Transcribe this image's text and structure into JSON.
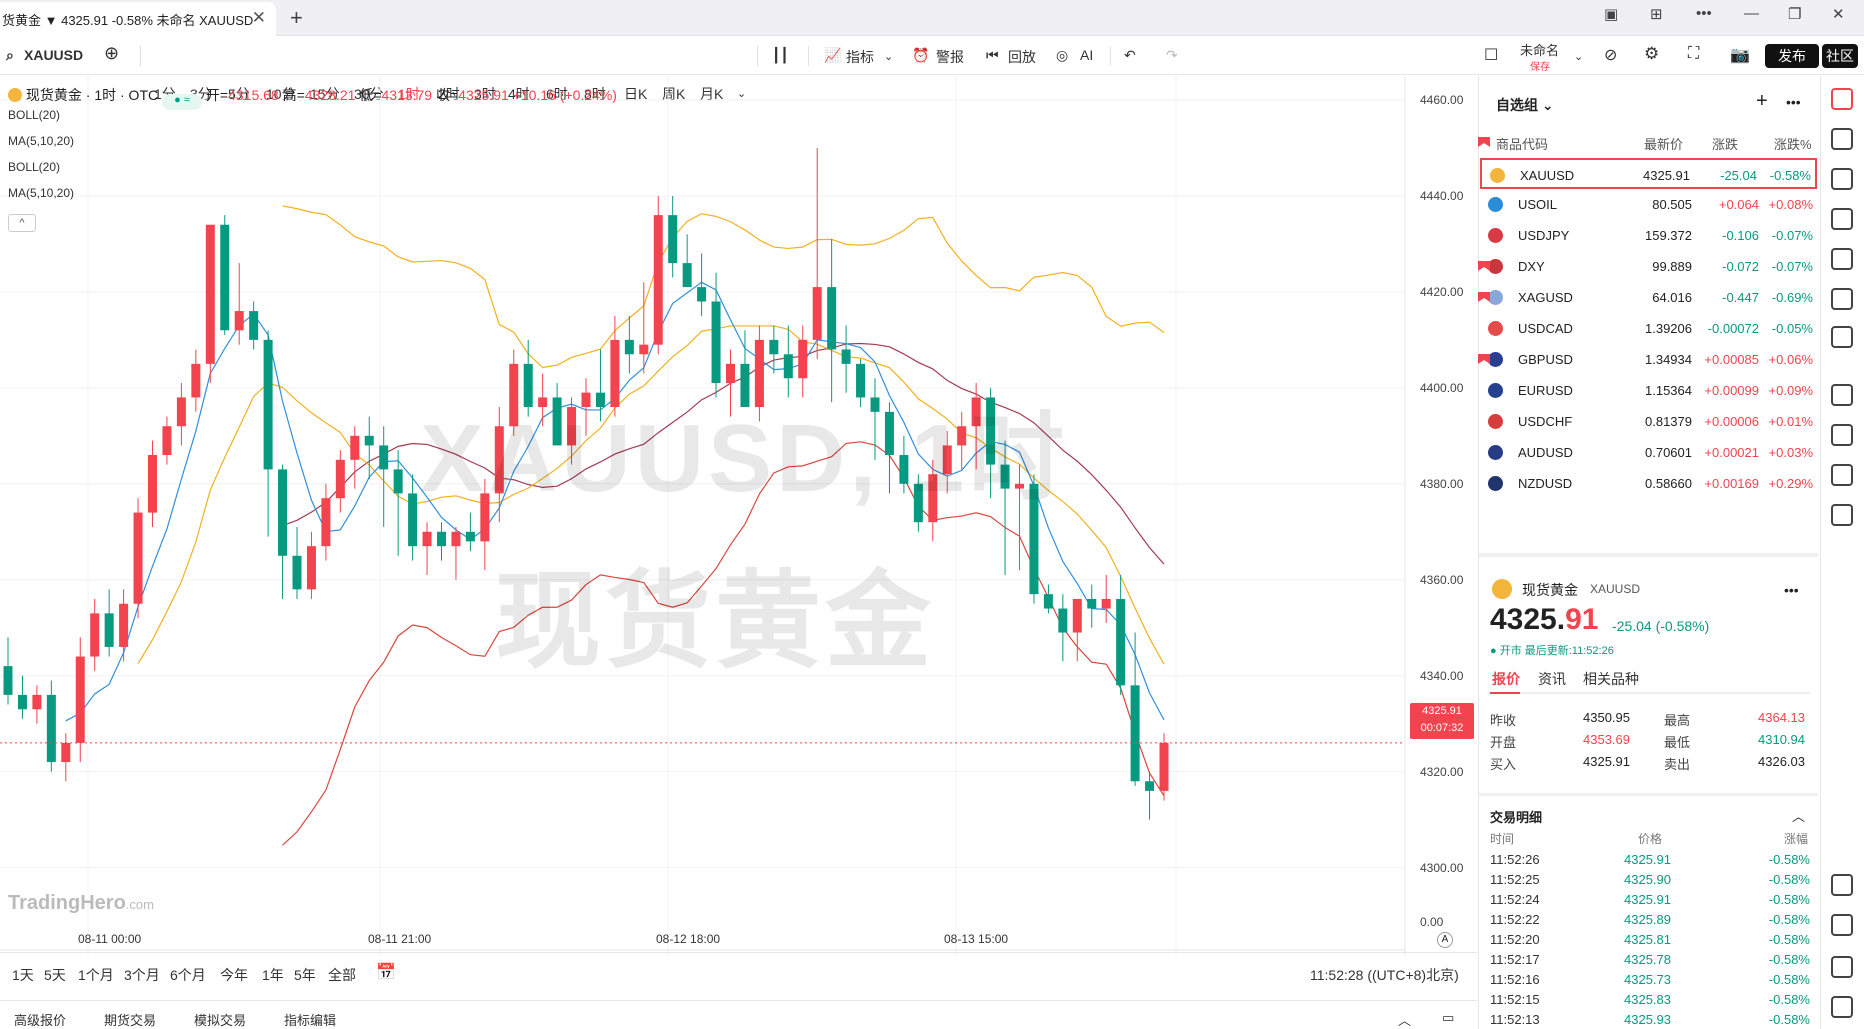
{
  "tab": {
    "title": "货黄金 ▼ 4325.91 -0.58% 未命名 XAUUSD"
  },
  "toolbar": {
    "symbol": "XAUUSD",
    "intervals": [
      "1分",
      "3分",
      "5分",
      "10分",
      "15分",
      "30分",
      "1时",
      "2时",
      "3时",
      "4时",
      "6时",
      "8时",
      "日K",
      "周K",
      "月K"
    ],
    "active_interval": "1时",
    "indicator": "指标",
    "alert": "警报",
    "replay": "回放",
    "ai": "AI",
    "layout_name": "未命名",
    "layout_save": "保存",
    "publish": "发布",
    "community": "社区"
  },
  "legend": {
    "name": "现货黄金 · 1时 · OTC",
    "open_label": "开=",
    "open": "4315.68",
    "high_label": "高=",
    "high": "4328.21",
    "low_label": "低=",
    "low": "4313.79",
    "close_label": "收=",
    "close": "4325.91",
    "change": "+10.16 (+0.24%)"
  },
  "indicators": [
    "BOLL(20)",
    "MA(5,10,20)",
    "BOLL(20)",
    "MA(5,10,20)"
  ],
  "watermark": {
    "line1": "XAUUSD, 1时",
    "line2": "现货黄金"
  },
  "brand": {
    "name": "TradingHero",
    "suffix": ".com"
  },
  "price_tag": {
    "price": "4325.91",
    "countdown": "00:07:32"
  },
  "volume_zero": "0.00",
  "ranges": [
    "1天",
    "5天",
    "1个月",
    "3个月",
    "6个月",
    "今年",
    "1年",
    "5年",
    "全部"
  ],
  "clock": "11:52:28 ((UTC+8)北京)",
  "bottom_tabs": [
    "高级报价",
    "期货交易",
    "模拟交易",
    "指标编辑"
  ],
  "chart_data": {
    "type": "candlestick",
    "y_ticks": [
      "4460.00",
      "4440.00",
      "4420.00",
      "4400.00",
      "4380.00",
      "4360.00",
      "4340.00",
      "4320.00",
      "4300.00"
    ],
    "x_ticks": [
      "08-11 00:00",
      "08-11 21:00",
      "08-12 18:00",
      "08-13 15:00"
    ],
    "ylim": [
      4292,
      4465
    ],
    "candles": [
      [
        4342,
        4348,
        4334,
        4336
      ],
      [
        4336,
        4340,
        4331,
        4333
      ],
      [
        4333,
        4338,
        4330,
        4336
      ],
      [
        4336,
        4339,
        4320,
        4322
      ],
      [
        4322,
        4328,
        4318,
        4326
      ],
      [
        4326,
        4348,
        4322,
        4344
      ],
      [
        4344,
        4356,
        4341,
        4353
      ],
      [
        4353,
        4358,
        4344,
        4346
      ],
      [
        4346,
        4358,
        4343,
        4355
      ],
      [
        4355,
        4377,
        4352,
        4374
      ],
      [
        4374,
        4389,
        4371,
        4386
      ],
      [
        4386,
        4394,
        4384,
        4392
      ],
      [
        4392,
        4401,
        4388,
        4398
      ],
      [
        4398,
        4408,
        4395,
        4405
      ],
      [
        4405,
        4428,
        4401,
        4434
      ],
      [
        4434,
        4436,
        4411,
        4412
      ],
      [
        4412,
        4426,
        4409,
        4416
      ],
      [
        4416,
        4418,
        4408,
        4410
      ],
      [
        4410,
        4412,
        4369,
        4383
      ],
      [
        4383,
        4384,
        4356,
        4365
      ],
      [
        4365,
        4371,
        4356,
        4358
      ],
      [
        4358,
        4370,
        4356,
        4367
      ],
      [
        4367,
        4380,
        4364,
        4377
      ],
      [
        4377,
        4387,
        4374,
        4385
      ],
      [
        4385,
        4392,
        4379,
        4390
      ],
      [
        4390,
        4394,
        4381,
        4388
      ],
      [
        4388,
        4392,
        4371,
        4383
      ],
      [
        4383,
        4387,
        4365,
        4378
      ],
      [
        4378,
        4382,
        4364,
        4367
      ],
      [
        4367,
        4372,
        4361,
        4370
      ],
      [
        4370,
        4372,
        4364,
        4367
      ],
      [
        4367,
        4371,
        4360,
        4370
      ],
      [
        4370,
        4374,
        4366,
        4368
      ],
      [
        4368,
        4381,
        4362,
        4378
      ],
      [
        4378,
        4396,
        4372,
        4392
      ],
      [
        4392,
        4408,
        4390,
        4405
      ],
      [
        4405,
        4410,
        4394,
        4396
      ],
      [
        4396,
        4403,
        4392,
        4398
      ],
      [
        4398,
        4401,
        4390,
        4388
      ],
      [
        4388,
        4398,
        4384,
        4396
      ],
      [
        4396,
        4402,
        4390,
        4399
      ],
      [
        4399,
        4408,
        4393,
        4396
      ],
      [
        4396,
        4415,
        4394,
        4410
      ],
      [
        4410,
        4415,
        4403,
        4407
      ],
      [
        4407,
        4422,
        4403,
        4409
      ],
      [
        4409,
        4440,
        4407,
        4436
      ],
      [
        4436,
        4440,
        4423,
        4426
      ],
      [
        4426,
        4432,
        4421,
        4421
      ],
      [
        4421,
        4428,
        4415,
        4418
      ],
      [
        4418,
        4424,
        4398,
        4401
      ],
      [
        4401,
        4408,
        4394,
        4405
      ],
      [
        4405,
        4412,
        4396,
        4396
      ],
      [
        4396,
        4413,
        4393,
        4410
      ],
      [
        4410,
        4413,
        4403,
        4407
      ],
      [
        4407,
        4413,
        4398,
        4402
      ],
      [
        4402,
        4413,
        4398,
        4410
      ],
      [
        4410,
        4450,
        4406,
        4421
      ],
      [
        4421,
        4431,
        4397,
        4408
      ],
      [
        4408,
        4413,
        4399,
        4405
      ],
      [
        4405,
        4406,
        4396,
        4398
      ],
      [
        4398,
        4402,
        4385,
        4395
      ],
      [
        4395,
        4397,
        4378,
        4386
      ],
      [
        4386,
        4390,
        4378,
        4380
      ],
      [
        4380,
        4382,
        4370,
        4372
      ],
      [
        4372,
        4385,
        4368,
        4382
      ],
      [
        4382,
        4391,
        4378,
        4388
      ],
      [
        4388,
        4395,
        4383,
        4392
      ],
      [
        4392,
        4401,
        4383,
        4398
      ],
      [
        4398,
        4400,
        4377,
        4384
      ],
      [
        4384,
        4389,
        4361,
        4379
      ],
      [
        4379,
        4384,
        4362,
        4380
      ],
      [
        4380,
        4382,
        4355,
        4357
      ],
      [
        4357,
        4359,
        4353,
        4354
      ],
      [
        4354,
        4357,
        4343,
        4349
      ],
      [
        4349,
        4356,
        4343,
        4356
      ],
      [
        4356,
        4359,
        4350,
        4354
      ],
      [
        4354,
        4361,
        4351,
        4356
      ],
      [
        4356,
        4361,
        4336,
        4338
      ],
      [
        4338,
        4349,
        4317,
        4318
      ],
      [
        4318,
        4320,
        4310,
        4316
      ],
      [
        4316,
        4328,
        4314,
        4326
      ]
    ]
  },
  "watchlist": {
    "title": "自选组",
    "headers": [
      "商品代码",
      "最新价",
      "涨跌",
      "涨跌%"
    ],
    "rows": [
      {
        "sym": "XAUUSD",
        "px": "4325.91",
        "ch": "-25.04",
        "pct": "-0.58%",
        "dir": "dn",
        "flag": "#f3b53c",
        "selected": true,
        "mark": false
      },
      {
        "sym": "USOIL",
        "px": "80.505",
        "ch": "+0.064",
        "pct": "+0.08%",
        "dir": "up",
        "flag": "#2a8bd6",
        "selected": false,
        "mark": false
      },
      {
        "sym": "USDJPY",
        "px": "159.372",
        "ch": "-0.106",
        "pct": "-0.07%",
        "dir": "dn",
        "flag": "#d93b46",
        "selected": false,
        "mark": false
      },
      {
        "sym": "DXY",
        "px": "99.889",
        "ch": "-0.072",
        "pct": "-0.07%",
        "dir": "dn",
        "flag": "#c9363c",
        "selected": false,
        "mark": true
      },
      {
        "sym": "XAGUSD",
        "px": "64.016",
        "ch": "-0.447",
        "pct": "-0.69%",
        "dir": "dn",
        "flag": "#8ba6d8",
        "selected": false,
        "mark": true
      },
      {
        "sym": "USDCAD",
        "px": "1.39206",
        "ch": "-0.00072",
        "pct": "-0.05%",
        "dir": "dn",
        "flag": "#e44b4b",
        "selected": false,
        "mark": false
      },
      {
        "sym": "GBPUSD",
        "px": "1.34934",
        "ch": "+0.00085",
        "pct": "+0.06%",
        "dir": "up",
        "flag": "#2c3f8f",
        "selected": false,
        "mark": true
      },
      {
        "sym": "EURUSD",
        "px": "1.15364",
        "ch": "+0.00099",
        "pct": "+0.09%",
        "dir": "up",
        "flag": "#24408e",
        "selected": false,
        "mark": false
      },
      {
        "sym": "USDCHF",
        "px": "0.81379",
        "ch": "+0.00006",
        "pct": "+0.01%",
        "dir": "up",
        "flag": "#d63d3d",
        "selected": false,
        "mark": false
      },
      {
        "sym": "AUDUSD",
        "px": "0.70601",
        "ch": "+0.00021",
        "pct": "+0.03%",
        "dir": "up",
        "flag": "#263d86",
        "selected": false,
        "mark": false
      },
      {
        "sym": "NZDUSD",
        "px": "0.58660",
        "ch": "+0.00169",
        "pct": "+0.29%",
        "dir": "up",
        "flag": "#1f356e",
        "selected": false,
        "mark": false
      }
    ]
  },
  "detail": {
    "title": "现货黄金",
    "symbol": "XAUUSD",
    "price_int": "4325.",
    "price_dec": "91",
    "change": "-25.04 (-0.58%)",
    "market": "● 开市 最后更新:11:52:26",
    "tabs": [
      "报价",
      "资讯",
      "相关品种"
    ],
    "quote": [
      {
        "l1": "昨收",
        "v1": "4350.95",
        "c1": "#222",
        "l2": "最高",
        "v2": "4364.13",
        "c2": "#f2434e"
      },
      {
        "l1": "开盘",
        "v1": "4353.69",
        "c1": "#f2434e",
        "l2": "最低",
        "v2": "4310.94",
        "c2": "#089981"
      },
      {
        "l1": "买入",
        "v1": "4325.91",
        "c1": "#222",
        "l2": "卖出",
        "v2": "4326.03",
        "c2": "#222"
      }
    ],
    "trades_title": "交易明细",
    "trades_headers": [
      "时间",
      "价格",
      "涨幅"
    ],
    "trades": [
      {
        "t": "11:52:26",
        "p": "4325.91",
        "c": "-0.58%"
      },
      {
        "t": "11:52:25",
        "p": "4325.90",
        "c": "-0.58%"
      },
      {
        "t": "11:52:24",
        "p": "4325.91",
        "c": "-0.58%"
      },
      {
        "t": "11:52:22",
        "p": "4325.89",
        "c": "-0.58%"
      },
      {
        "t": "11:52:20",
        "p": "4325.81",
        "c": "-0.58%"
      },
      {
        "t": "11:52:17",
        "p": "4325.78",
        "c": "-0.58%"
      },
      {
        "t": "11:52:16",
        "p": "4325.73",
        "c": "-0.58%"
      },
      {
        "t": "11:52:15",
        "p": "4325.83",
        "c": "-0.58%"
      },
      {
        "t": "11:52:13",
        "p": "4325.93",
        "c": "-0.58%"
      }
    ]
  },
  "colors": {
    "up": "#f2434e",
    "down": "#089981",
    "ma5": "#2f8fdd",
    "ma10": "#f2b01e",
    "ma20": "#a33b4f",
    "boll": "#d9473d"
  }
}
